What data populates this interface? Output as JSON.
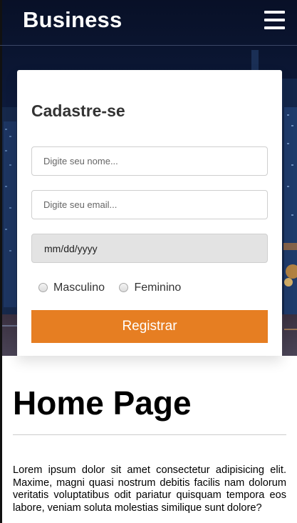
{
  "navbar": {
    "brand": "Business",
    "menu_icon": "hamburger-menu-icon"
  },
  "form": {
    "title": "Cadastre-se",
    "name_placeholder": "Digite seu nome...",
    "email_placeholder": "Digite seu email...",
    "date_placeholder": "mm/dd/yyyy",
    "gender_options": [
      "Masculino",
      "Feminino"
    ],
    "submit_label": "Registrar"
  },
  "main": {
    "heading": "Home Page",
    "paragraph": "Lorem ipsum dolor sit amet consectetur adipisicing elit. Maxime, magni quasi nostrum debitis facilis nam dolorum veritatis voluptatibus odit pariatur quisquam tempora eos labore, veniam soluta molestias similique sunt dolore?"
  },
  "colors": {
    "accent": "#e67e22",
    "hero_background": "#0d1a3a",
    "text": "#333333"
  }
}
